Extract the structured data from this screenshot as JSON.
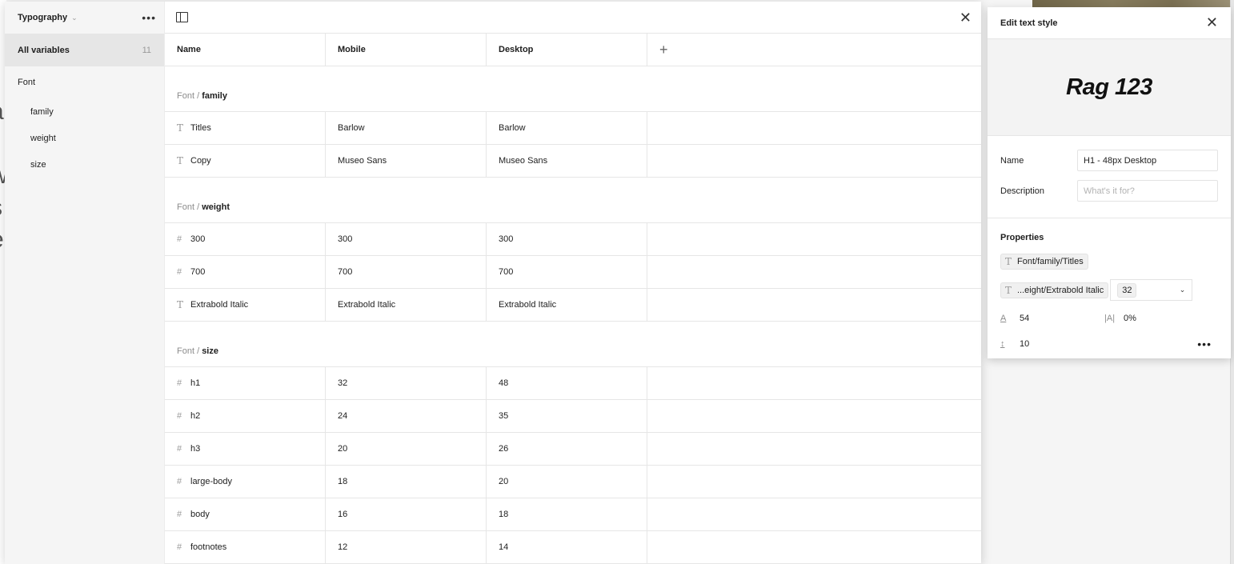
{
  "sidebar": {
    "collection_title": "Typography",
    "all_variables_label": "All variables",
    "all_variables_count": "11",
    "group_label": "Font",
    "items": [
      {
        "label": "family"
      },
      {
        "label": "weight"
      },
      {
        "label": "size"
      }
    ]
  },
  "table": {
    "columns": [
      "Name",
      "Mobile",
      "Desktop"
    ],
    "groups": [
      {
        "prefix": "Font /",
        "name": "family",
        "rows": [
          {
            "type": "string",
            "name": "Titles",
            "mobile": "Barlow",
            "desktop": "Barlow"
          },
          {
            "type": "string",
            "name": "Copy",
            "mobile": "Museo Sans",
            "desktop": "Museo Sans"
          }
        ]
      },
      {
        "prefix": "Font /",
        "name": "weight",
        "rows": [
          {
            "type": "number",
            "name": "300",
            "mobile": "300",
            "desktop": "300"
          },
          {
            "type": "number",
            "name": "700",
            "mobile": "700",
            "desktop": "700"
          },
          {
            "type": "string",
            "name": "Extrabold Italic",
            "mobile": "Extrabold Italic",
            "desktop": "Extrabold Italic"
          }
        ]
      },
      {
        "prefix": "Font /",
        "name": "size",
        "rows": [
          {
            "type": "number",
            "name": "h1",
            "mobile": "32",
            "desktop": "48"
          },
          {
            "type": "number",
            "name": "h2",
            "mobile": "24",
            "desktop": "35"
          },
          {
            "type": "number",
            "name": "h3",
            "mobile": "20",
            "desktop": "26"
          },
          {
            "type": "number",
            "name": "large-body",
            "mobile": "18",
            "desktop": "20"
          },
          {
            "type": "number",
            "name": "body",
            "mobile": "16",
            "desktop": "18"
          },
          {
            "type": "number",
            "name": "footnotes",
            "mobile": "12",
            "desktop": "14"
          }
        ]
      }
    ]
  },
  "icons": {
    "string": "T",
    "number": "#",
    "add": "+",
    "close": "✕",
    "more": "•••",
    "chevron_down": "⌄"
  },
  "edit_panel": {
    "title": "Edit text style",
    "preview_text": "Rag 123",
    "name_label": "Name",
    "name_value": "H1 - 48px Desktop",
    "description_label": "Description",
    "description_placeholder": "What's it for?",
    "properties_title": "Properties",
    "font_family": "Font/family/Titles",
    "font_weight": "...eight/Extrabold Italic",
    "font_size": "32",
    "line_height": "54",
    "letter_spacing": "0%",
    "paragraph_spacing": "10"
  }
}
